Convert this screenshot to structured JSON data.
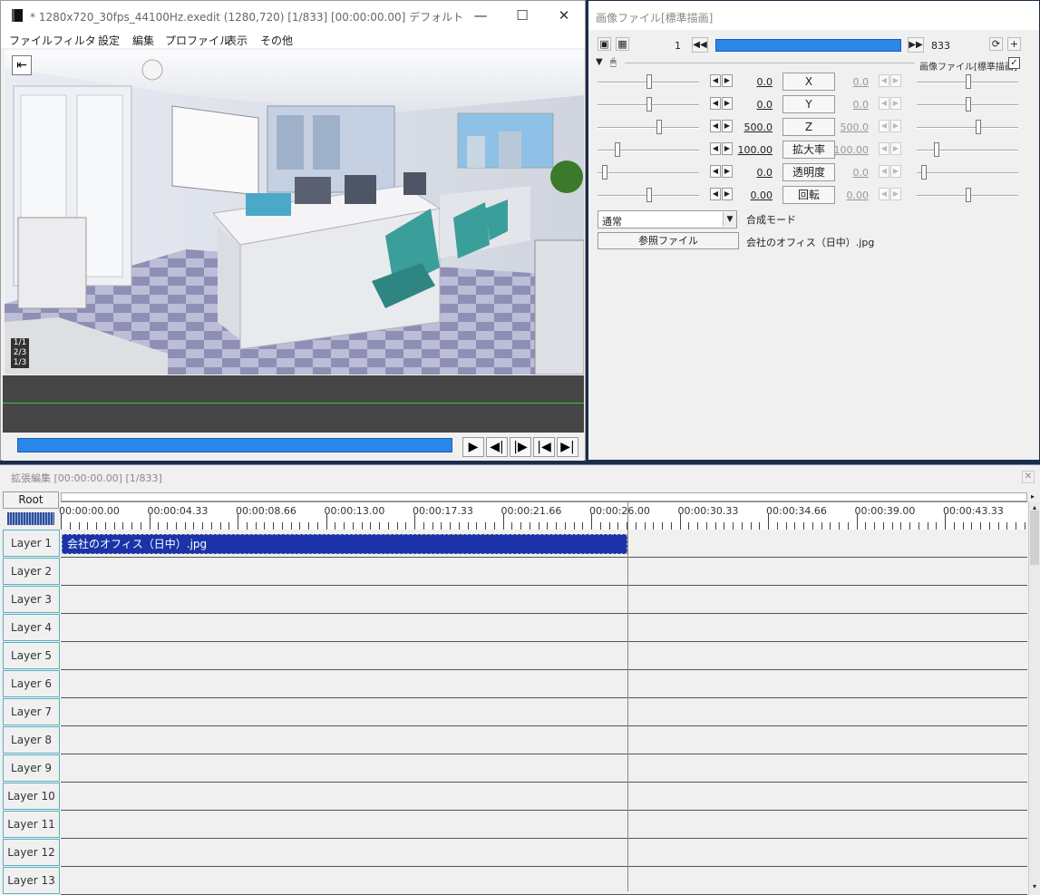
{
  "main_window": {
    "title": "* 1280x720_30fps_44100Hz.exedit (1280,720)  [1/833] [00:00:00.00]  デフォルト",
    "minimize_glyph": "—",
    "maximize_glyph": "☐",
    "close_glyph": "✕",
    "menu": [
      "ファイル",
      "フィルタ",
      "設定",
      "編集",
      "プロファイル",
      "表示",
      "その他"
    ],
    "frame_badges": [
      "1/1",
      "2/3",
      "1/3"
    ],
    "transport": {
      "play": "▶",
      "prev_frame": "◀|",
      "next_frame": "|▶",
      "go_start": "|◀",
      "go_end": "▶|"
    }
  },
  "prop_window": {
    "title": "画像ファイル[標準描画]",
    "frame_start": "1",
    "frame_end": "833",
    "frame_progress": 1.0,
    "object_label": "画像ファイル[標準描画]",
    "object_checked": true,
    "params": [
      {
        "name": "X",
        "left": "0.0",
        "right": "0.0",
        "left_pos": 0.5,
        "right_pos": 0.5
      },
      {
        "name": "Y",
        "left": "0.0",
        "right": "0.0",
        "left_pos": 0.5,
        "right_pos": 0.5
      },
      {
        "name": "Z",
        "left": "500.0",
        "right": "500.0",
        "left_pos": 0.6,
        "right_pos": 0.6
      },
      {
        "name": "拡大率",
        "left": "100.00",
        "right": "100.00",
        "left_pos": 0.18,
        "right_pos": 0.18
      },
      {
        "name": "透明度",
        "left": "0.0",
        "right": "0.0",
        "left_pos": 0.05,
        "right_pos": 0.05
      },
      {
        "name": "回転",
        "left": "0.00",
        "right": "0.00",
        "left_pos": 0.5,
        "right_pos": 0.5
      }
    ],
    "blend_mode_value": "通常",
    "blend_mode_label": "合成モード",
    "ref_file_button": "参照ファイル",
    "ref_file_name": "会社のオフィス（日中）.jpg"
  },
  "timeline": {
    "title": "拡張編集 [00:00:00.00] [1/833]",
    "root_label": "Root",
    "close_glyph": "✕",
    "ticks": [
      "00:00:00.00",
      "00:00:04.33",
      "00:00:08.66",
      "00:00:13.00",
      "00:00:17.33",
      "00:00:21.66",
      "00:00:26.00",
      "00:00:30.33",
      "00:00:34.66",
      "00:00:39.00",
      "00:00:43.33"
    ],
    "layers": [
      "Layer 1",
      "Layer 2",
      "Layer 3",
      "Layer 4",
      "Layer 5",
      "Layer 6",
      "Layer 7",
      "Layer 8",
      "Layer 9",
      "Layer 10",
      "Layer 11",
      "Layer 12",
      "Layer 13"
    ],
    "clip_label": "会社のオフィス（日中）.jpg",
    "colors": {
      "clip": "#1a33a8",
      "seekbar": "#2a86e8",
      "layer_border": "#5ab0c0"
    }
  }
}
